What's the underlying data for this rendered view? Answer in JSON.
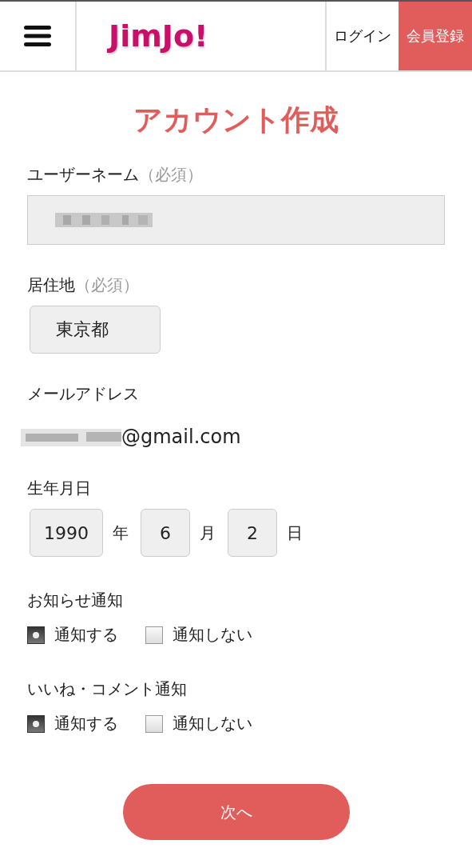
{
  "header": {
    "logo": "JimJo!",
    "login": "ログイン",
    "register": "会員登録"
  },
  "title": "アカウント作成",
  "username": {
    "label": "ユーザーネーム",
    "required": "（必須）"
  },
  "residence": {
    "label": "居住地",
    "required": "（必須）",
    "value": "東京都"
  },
  "email": {
    "label": "メールアドレス",
    "value": "@gmail.com"
  },
  "birthday": {
    "label": "生年月日",
    "year": "1990",
    "year_unit": "年",
    "month": "6",
    "month_unit": "月",
    "day": "2",
    "day_unit": "日"
  },
  "notifications": [
    {
      "label": "お知らせ通知",
      "options": [
        {
          "label": "通知する",
          "selected": true
        },
        {
          "label": "通知しない",
          "selected": false
        }
      ]
    },
    {
      "label": "いいね・コメント通知",
      "options": [
        {
          "label": "通知する",
          "selected": true
        },
        {
          "label": "通知しない",
          "selected": false
        }
      ]
    }
  ],
  "next_button": "次へ"
}
